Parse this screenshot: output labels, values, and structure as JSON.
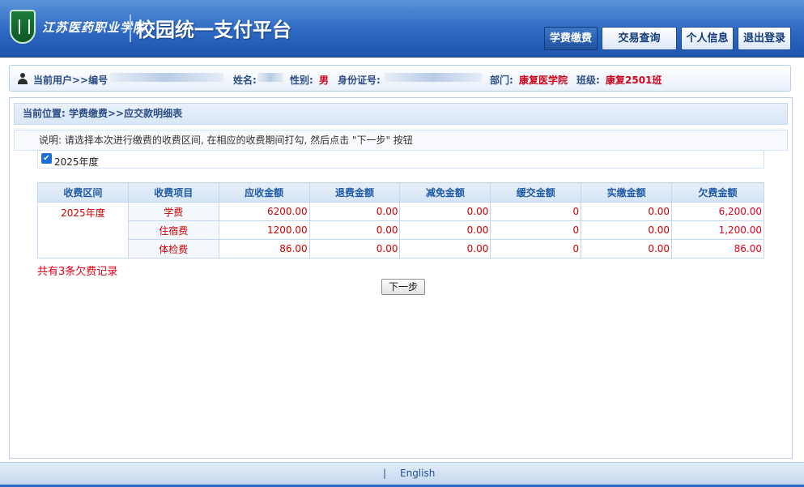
{
  "header": {
    "school_name": "江苏医药职业学院",
    "platform_title": "校园统一支付平台",
    "nav": [
      {
        "label": "学费缴费",
        "active": true
      },
      {
        "label": "交易查询",
        "active": false
      },
      {
        "label": "个人信息",
        "active": false
      },
      {
        "label": "退出登录",
        "active": false
      }
    ]
  },
  "user_bar": {
    "current_user_label": "当前用户>>编号",
    "name_label": "姓名:",
    "gender_label": "性别:",
    "gender_value": "男",
    "id_label": "身份证号:",
    "dept_label": "部门:",
    "dept_value": "康复医学院",
    "class_label": "班级:",
    "class_value": "康复2501班"
  },
  "breadcrumb": "当前位置: 学费缴费>>应交款明细表",
  "instruction": "说明: 请选择本次进行缴费的收费区间, 在相应的收费期间打勾, 然后点击 \"下一步\" 按钮",
  "year_option": {
    "label": "2025年度",
    "checked": true
  },
  "table": {
    "headers": [
      "收费区间",
      "收费项目",
      "应收金额",
      "退费金额",
      "减免金额",
      "缓交金额",
      "实缴金额",
      "欠费金额"
    ],
    "period": "2025年度",
    "rows": [
      {
        "item": "学费",
        "receivable": "6200.00",
        "refund": "0.00",
        "reduction": "0.00",
        "deferred": "0",
        "paid": "0.00",
        "owed": "6,200.00"
      },
      {
        "item": "住宿费",
        "receivable": "1200.00",
        "refund": "0.00",
        "reduction": "0.00",
        "deferred": "0",
        "paid": "0.00",
        "owed": "1,200.00"
      },
      {
        "item": "体检费",
        "receivable": "86.00",
        "refund": "0.00",
        "reduction": "0.00",
        "deferred": "0",
        "paid": "0.00",
        "owed": "86.00"
      }
    ]
  },
  "summary": "共有3条欠费记录",
  "next_button": "下一步",
  "footer": {
    "separator": "|",
    "language_link": "English"
  },
  "colors": {
    "header_blue": "#2d68c2",
    "accent_red": "#e0001a",
    "table_header_text": "#1f5aa6"
  }
}
